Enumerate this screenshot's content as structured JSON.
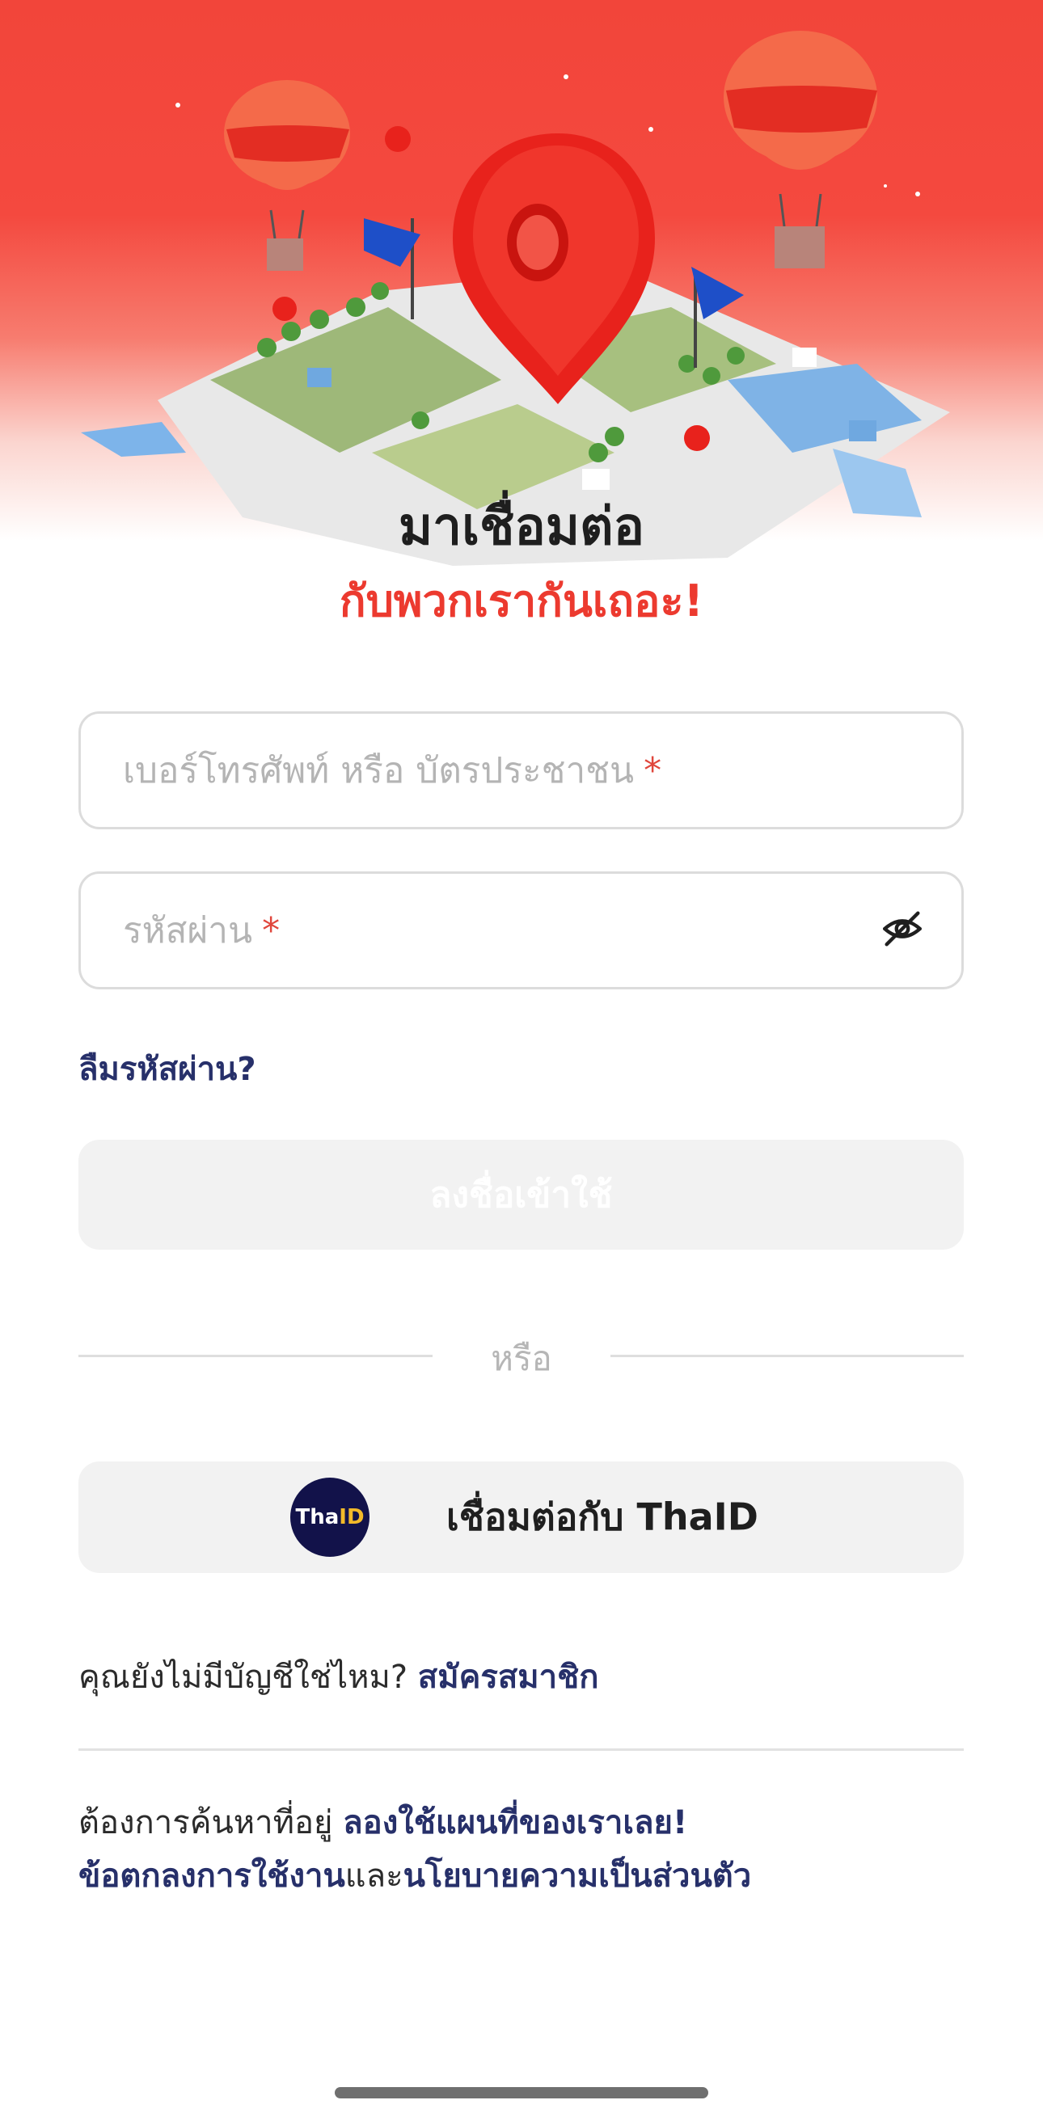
{
  "hero": {
    "title": "มาเชื่อมต่อ",
    "subtitle": "กับพวกเรากันเถอะ!"
  },
  "form": {
    "id_placeholder": "เบอร์โทรศัพท์ หรือ บัตรประชาชน",
    "password_placeholder": "รหัสผ่าน",
    "required_mark": "*",
    "forgot_password": "ลืมรหัสผ่าน?",
    "login_button": "ลงชื่อเข้าใช้"
  },
  "divider": {
    "or": "หรือ"
  },
  "thaid": {
    "label": "เชื่อมต่อกับ ThaID",
    "logo_tha": "Tha",
    "logo_id": "ID"
  },
  "signup": {
    "prompt": "คุณยังไม่มีบัญชีใช่ไหม?",
    "link": "สมัครสมาชิก"
  },
  "footer": {
    "map_prompt": "ต้องการค้นหาที่อยู่",
    "map_link": "ลองใช้แผนที่ของเราเลย!",
    "terms_link": "ข้อตกลงการใช้งาน",
    "and": "และ",
    "privacy_link": "นโยบายความเป็นส่วนตัว"
  },
  "icons": {
    "password_toggle": "eye-off-icon",
    "hero_illustration": "map-pin-icon"
  },
  "colors": {
    "brand_red": "#ec3a2f",
    "link_navy": "#27306a",
    "thaid_navy": "#12124a",
    "thaid_gold": "#f2b929"
  }
}
